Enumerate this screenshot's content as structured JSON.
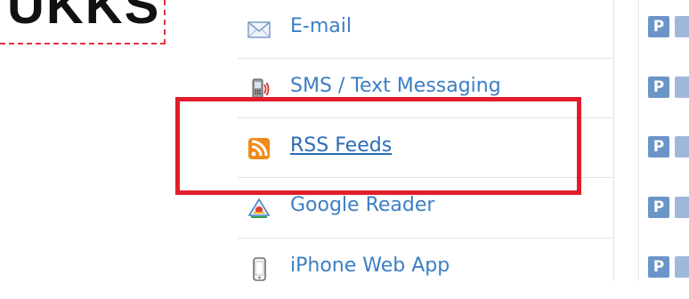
{
  "page": {
    "heading_fragment": "UKKS"
  },
  "list": {
    "items": [
      {
        "label": "E-mail",
        "icon": "email-icon",
        "link": false
      },
      {
        "label": "SMS / Text Messaging",
        "icon": "phone-icon",
        "link": false
      },
      {
        "label": "RSS Feeds",
        "icon": "rss-icon",
        "link": true
      },
      {
        "label": "Google Reader",
        "icon": "google-reader-icon",
        "link": false
      },
      {
        "label": "iPhone Web App",
        "icon": "iphone-icon",
        "link": false
      }
    ]
  },
  "side": {
    "badge_label": "P"
  },
  "colors": {
    "highlight": "#e11d2a",
    "link": "#3c7fc4",
    "badge": "#6b95c8",
    "rss": "#f28a1a"
  }
}
